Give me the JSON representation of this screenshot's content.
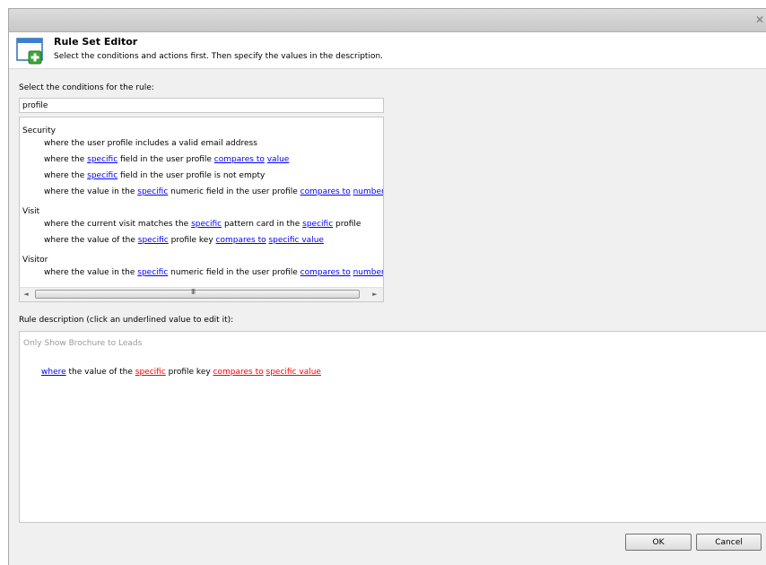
{
  "dialog": {
    "close_glyph": "✕",
    "title": "Rule Set Editor",
    "subtitle": "Select the conditions and actions first. Then specify the values in the description."
  },
  "conditions": {
    "label": "Select the conditions for the rule:",
    "search_value": "profile",
    "groups": [
      {
        "name": "Security",
        "items": [
          [
            {
              "t": "where the user profile includes a valid email address"
            }
          ],
          [
            {
              "t": "where the "
            },
            {
              "l": "specific"
            },
            {
              "t": " field in the user profile "
            },
            {
              "l": "compares to"
            },
            {
              "t": " "
            },
            {
              "l": "value"
            }
          ],
          [
            {
              "t": "where the "
            },
            {
              "l": "specific"
            },
            {
              "t": " field in the user profile is not empty"
            }
          ],
          [
            {
              "t": "where the value in the "
            },
            {
              "l": "specific"
            },
            {
              "t": " numeric field in the user profile "
            },
            {
              "l": "compares to"
            },
            {
              "t": " "
            },
            {
              "l": "number"
            }
          ]
        ]
      },
      {
        "name": "Visit",
        "items": [
          [
            {
              "t": "where the current visit matches the "
            },
            {
              "l": "specific"
            },
            {
              "t": " pattern card in the "
            },
            {
              "l": "specific"
            },
            {
              "t": " profile"
            }
          ],
          [
            {
              "t": "where the value of the "
            },
            {
              "l": "specific"
            },
            {
              "t": " profile key "
            },
            {
              "l": "compares to"
            },
            {
              "t": " "
            },
            {
              "l": "specific value"
            }
          ]
        ]
      },
      {
        "name": "Visitor",
        "items": [
          [
            {
              "t": "where the value in the "
            },
            {
              "l": "specific"
            },
            {
              "t": " numeric field in the user profile "
            },
            {
              "l": "compares to"
            },
            {
              "t": " "
            },
            {
              "l": "number"
            }
          ]
        ]
      }
    ],
    "scroll_left": "◄",
    "scroll_right": "►",
    "scroll_grip": "III"
  },
  "description": {
    "label": "Rule description (click an underlined value to edit it):",
    "rule_name": "Only Show Brochure to Leads",
    "rule_parts": [
      {
        "l": "where",
        "c": "blue"
      },
      {
        "t": " the value of the "
      },
      {
        "l": "specific",
        "c": "red"
      },
      {
        "t": " profile key "
      },
      {
        "l": "compares to",
        "c": "red"
      },
      {
        "t": " "
      },
      {
        "l": "specific value",
        "c": "red"
      }
    ]
  },
  "buttons": {
    "ok": "OK",
    "cancel": "Cancel"
  },
  "colors": {
    "link": "#0000ff",
    "unset_link": "#ff0000",
    "dialog_bg": "#f0f0f0"
  }
}
